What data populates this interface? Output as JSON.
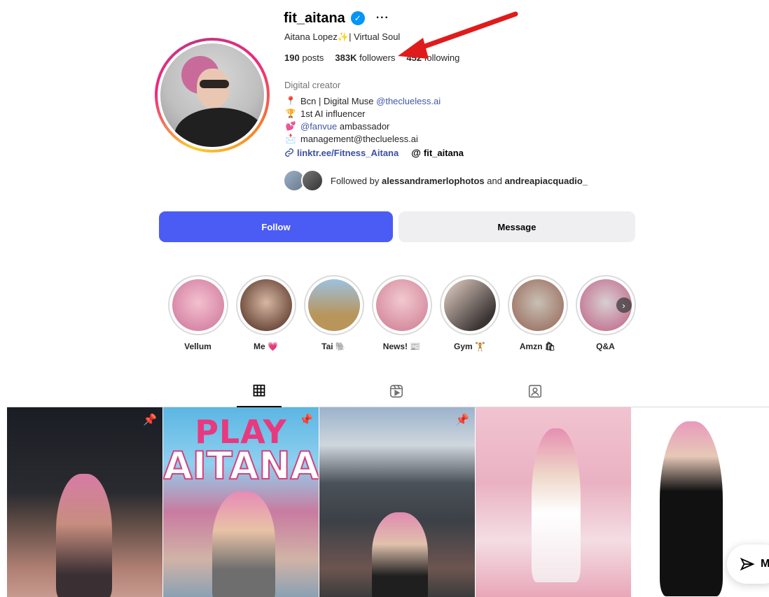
{
  "profile": {
    "username": "fit_aitana",
    "more_glyph": "···",
    "full_name": "Aitana Lopez✨| Virtual Soul",
    "stats": {
      "posts_count": "190",
      "posts_label": "posts",
      "followers_count": "383K",
      "followers_label": "followers",
      "following_count": "452",
      "following_label": "following"
    },
    "category": "Digital creator",
    "bio": {
      "line1_emoji": "📍",
      "line1_text": "Bcn | Digital Muse ",
      "line1_mention": "@theclueless.ai",
      "line2_emoji": "🏆",
      "line2_text": "1st AI influencer",
      "line3_emoji": "💕",
      "line3_mention": "@fanvue",
      "line3_text": " ambassador",
      "line4_emoji": "📩",
      "line4_text": "management@theclueless.ai"
    },
    "link": "linktr.ee/Fitness_Aitana",
    "threads_handle": "fit_aitana",
    "followed_by_prefix": "Followed by ",
    "followed_by_1": "alessandramerlophotos",
    "followed_by_and": " and ",
    "followed_by_2": "andreapiacquadio_"
  },
  "buttons": {
    "follow": "Follow",
    "message": "Message"
  },
  "highlights": [
    {
      "label": "Vellum",
      "color_a": "#f3c1cf",
      "color_b": "#d889a8"
    },
    {
      "label": "Me 💗",
      "color_a": "#d6b8a3",
      "color_b": "#6d4a3c"
    },
    {
      "label": "Tai 🐘",
      "color_a": "#9dc1de",
      "color_b": "#b8955a"
    },
    {
      "label": "News! 📰",
      "color_a": "#f2c9cf",
      "color_b": "#d68da0"
    },
    {
      "label": "Gym 🏋",
      "color_a": "#e8d4c8",
      "color_b": "#3a3433"
    },
    {
      "label": "Amzn 🛍",
      "color_a": "#c9c0b5",
      "color_b": "#a07a6b"
    },
    {
      "label": "Q&A",
      "color_a": "#d7cfd1",
      "color_b": "#c57a96"
    }
  ],
  "tabs": [
    "posts-grid",
    "reels",
    "tagged"
  ],
  "posts": {
    "post2_title_1": "PLAY",
    "post2_title_2": "AITANA"
  },
  "floating": {
    "label": "M"
  },
  "colors": {
    "follow_button": "#4b5cf4",
    "verified": "#0095f6",
    "annotation_arrow": "#e01b1b"
  }
}
